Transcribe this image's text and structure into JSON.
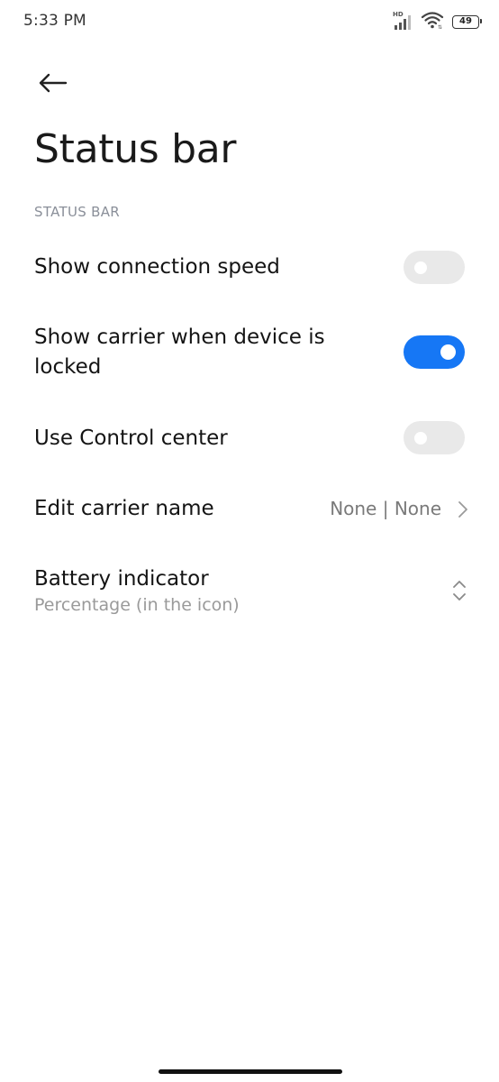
{
  "status_bar": {
    "time": "5:33 PM",
    "network_label": "HD",
    "battery_level": "49",
    "signal_icon": "cell-signal-icon",
    "wifi_icon": "wifi-icon"
  },
  "header": {
    "back_icon": "back-arrow-icon",
    "title": "Status bar"
  },
  "section": {
    "title": "STATUS BAR"
  },
  "settings": {
    "connection_speed": {
      "label": "Show connection speed",
      "enabled": false
    },
    "carrier_locked": {
      "label_line1": "Show carrier when device is",
      "label_line2": "locked",
      "enabled": true
    },
    "control_center": {
      "label": "Use Control center",
      "enabled": false
    },
    "carrier_name": {
      "label": "Edit carrier name",
      "value": "None | None"
    },
    "battery_indicator": {
      "label": "Battery indicator",
      "value": "Percentage (in the icon)"
    }
  },
  "colors": {
    "accent": "#1677f5",
    "toggle_off": "#e9e9e9",
    "secondary_text": "#9a9a9a",
    "section_text": "#8a8f99"
  }
}
